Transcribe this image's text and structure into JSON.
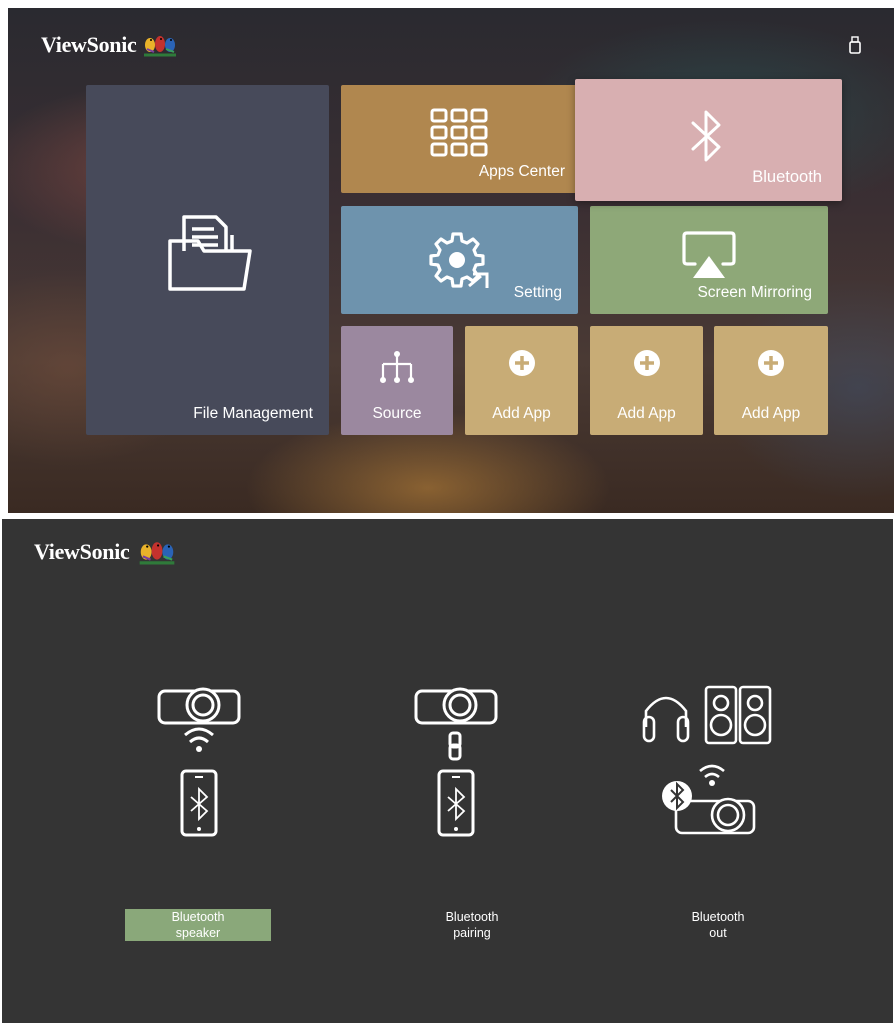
{
  "brand": {
    "name": "ViewSonic"
  },
  "home": {
    "usb_icon": "usb-drive-icon",
    "tiles": {
      "file_management": {
        "label": "File Management",
        "icon": "folder-documents-icon",
        "color": "#474a5a"
      },
      "apps_center": {
        "label": "Apps Center",
        "icon": "grid-apps-icon",
        "color": "#b0874f"
      },
      "bluetooth": {
        "label": "Bluetooth",
        "icon": "bluetooth-icon",
        "color": "#d8afb1",
        "focused": true
      },
      "setting": {
        "label": "Setting",
        "icon": "gear-icon",
        "color": "#6e93ad"
      },
      "screen_mirroring": {
        "label": "Screen Mirroring",
        "icon": "airplay-icon",
        "color": "#8ea878"
      },
      "source": {
        "label": "Source",
        "icon": "source-tree-icon",
        "color": "#9b889f"
      },
      "add_app_1": {
        "label": "Add App",
        "icon": "plus-circle-icon",
        "color": "#c8ac76"
      },
      "add_app_2": {
        "label": "Add App",
        "icon": "plus-circle-icon",
        "color": "#c8ac76"
      },
      "add_app_3": {
        "label": "Add App",
        "icon": "plus-circle-icon",
        "color": "#c8ac76"
      }
    }
  },
  "bluetooth_menu": {
    "background": "#343434",
    "selected_color": "#8aa87a",
    "options": [
      {
        "line1": "Bluetooth",
        "line2": "speaker",
        "icon": "projector-phone-wifi-icon",
        "selected": true
      },
      {
        "line1": "Bluetooth",
        "line2": "pairing",
        "icon": "projector-phone-link-icon",
        "selected": false
      },
      {
        "line1": "Bluetooth",
        "line2": "out",
        "icon": "projector-speakers-headphones-icon",
        "selected": false
      }
    ]
  }
}
